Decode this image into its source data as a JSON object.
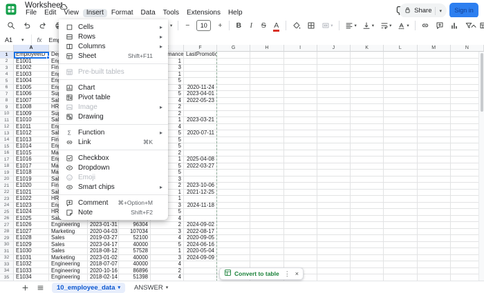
{
  "appbar": {
    "title": "Worksheet",
    "menu_items": [
      "File",
      "Edit",
      "View",
      "Insert",
      "Format",
      "Data",
      "Tools",
      "Extensions",
      "Help"
    ],
    "active_menu": "Insert",
    "share_label": "Share",
    "signin_label": "Sign in"
  },
  "icons": {
    "sigma": "Σ",
    "caret_down": "▾",
    "submenu_arrow": "▸",
    "minus": "−",
    "plus": "+",
    "bold": "B",
    "italic": "I",
    "strike": "S",
    "text_color": "A",
    "dots_vertical": "⋮",
    "close": "×"
  },
  "toolbar": {
    "font_size": "10"
  },
  "formula_bar": {
    "cell_ref": "A1",
    "fx": "fx",
    "value": "EmployeeID"
  },
  "insert_menu": {
    "items": [
      {
        "label": "Cells",
        "shortcut": "",
        "arrow": "▸",
        "disabled": false
      },
      {
        "label": "Rows",
        "shortcut": "",
        "arrow": "▸",
        "disabled": false
      },
      {
        "label": "Columns",
        "shortcut": "",
        "arrow": "▸",
        "disabled": false
      },
      {
        "label": "Sheet",
        "shortcut": "Shift+F11",
        "arrow": "",
        "disabled": false
      },
      {
        "label": "Pre-built tables",
        "shortcut": "",
        "arrow": "",
        "disabled": true
      },
      {
        "label": "Chart",
        "shortcut": "",
        "arrow": "",
        "disabled": false
      },
      {
        "label": "Pivot table",
        "shortcut": "",
        "arrow": "",
        "disabled": false
      },
      {
        "label": "Image",
        "shortcut": "",
        "arrow": "▸",
        "disabled": true
      },
      {
        "label": "Drawing",
        "shortcut": "",
        "arrow": "",
        "disabled": false
      },
      {
        "label": "Function",
        "shortcut": "",
        "arrow": "▸",
        "disabled": false
      },
      {
        "label": "Link",
        "shortcut": "⌘K",
        "arrow": "",
        "disabled": false
      },
      {
        "label": "Checkbox",
        "shortcut": "",
        "arrow": "",
        "disabled": false
      },
      {
        "label": "Dropdown",
        "shortcut": "",
        "arrow": "",
        "disabled": false
      },
      {
        "label": "Emoji",
        "shortcut": "",
        "arrow": "",
        "disabled": true
      },
      {
        "label": "Smart chips",
        "shortcut": "",
        "arrow": "▸",
        "disabled": false
      },
      {
        "label": "Comment",
        "shortcut": "⌘+Option+M",
        "arrow": "",
        "disabled": false
      },
      {
        "label": "Note",
        "shortcut": "Shift+F2",
        "arrow": "",
        "disabled": false
      }
    ]
  },
  "sheet": {
    "columns": [
      "A",
      "B",
      "C",
      "D",
      "E",
      "F",
      "G",
      "H",
      "I",
      "J",
      "K",
      "L",
      "M",
      "N"
    ],
    "selected_cell": "A1",
    "rows": [
      [
        "EmployeeID",
        "Department",
        "",
        "",
        "PerformanceRat",
        "LastPromotionDate"
      ],
      [
        "E1001",
        "Engineering",
        "",
        "",
        "1",
        ""
      ],
      [
        "E1002",
        "Finance",
        "",
        "",
        "3",
        ""
      ],
      [
        "E1003",
        "Engineering",
        "",
        "",
        "1",
        ""
      ],
      [
        "E1004",
        "Engineering",
        "",
        "",
        "5",
        ""
      ],
      [
        "E1005",
        "Engineering",
        "",
        "",
        "3",
        "2020-11-24"
      ],
      [
        "E1006",
        "Support",
        "",
        "",
        "5",
        "2023-04-01"
      ],
      [
        "E1007",
        "Sales",
        "",
        "",
        "4",
        "2022-05-23"
      ],
      [
        "E1008",
        "HR",
        "",
        "",
        "2",
        ""
      ],
      [
        "E1009",
        "Support",
        "",
        "",
        "2",
        ""
      ],
      [
        "E1010",
        "Sales",
        "",
        "",
        "1",
        "2023-03-21"
      ],
      [
        "E1011",
        "Engineering",
        "",
        "",
        "4",
        ""
      ],
      [
        "E1012",
        "Sales",
        "",
        "",
        "5",
        "2020-07-11"
      ],
      [
        "E1013",
        "Finance",
        "",
        "",
        "5",
        ""
      ],
      [
        "E1014",
        "Engineering",
        "",
        "",
        "5",
        ""
      ],
      [
        "E1015",
        "Marketing",
        "",
        "",
        "2",
        ""
      ],
      [
        "E1016",
        "Engineering",
        "",
        "",
        "1",
        "2025-04-08"
      ],
      [
        "E1017",
        "Marketing",
        "",
        "",
        "5",
        "2022-03-27"
      ],
      [
        "E1018",
        "Marketing",
        "",
        "",
        "5",
        ""
      ],
      [
        "E1019",
        "Sales",
        "",
        "",
        "3",
        ""
      ],
      [
        "E1020",
        "Finance",
        "",
        "",
        "2",
        "2023-10-06"
      ],
      [
        "E1021",
        "Sales",
        "",
        "",
        "1",
        "2021-12-25"
      ],
      [
        "E1022",
        "HR",
        "",
        "",
        "1",
        ""
      ],
      [
        "E1023",
        "Engineering",
        "",
        "",
        "3",
        "2024-11-18"
      ],
      [
        "E1024",
        "HR",
        "",
        "",
        "5",
        ""
      ],
      [
        "E1025",
        "Sales",
        "2019-11-03",
        "64961",
        "4",
        ""
      ],
      [
        "E1026",
        "Engineering",
        "2023-01-31",
        "96304",
        "2",
        "2024-09-02"
      ],
      [
        "E1027",
        "Marketing",
        "2020-04-03",
        "107034",
        "3",
        "2022-08-17"
      ],
      [
        "E1028",
        "Sales",
        "2019-03-27",
        "52100",
        "4",
        "2020-09-05"
      ],
      [
        "E1029",
        "Sales",
        "2023-04-17",
        "40000",
        "5",
        "2024-06-16"
      ],
      [
        "E1030",
        "Sales",
        "2018-08-12",
        "57528",
        "1",
        "2020-05-04"
      ],
      [
        "E1031",
        "Marketing",
        "2023-01-02",
        "40000",
        "3",
        "2024-09-09"
      ],
      [
        "E1032",
        "Engineering",
        "2018-07-07",
        "40000",
        "4",
        ""
      ],
      [
        "E1033",
        "Engineering",
        "2020-10-16",
        "86896",
        "2",
        ""
      ],
      [
        "E1034",
        "Engineering",
        "2018-02-14",
        "51398",
        "4",
        ""
      ]
    ]
  },
  "convert_pill": {
    "label": "Convert to table"
  },
  "tabs": {
    "active": "10_employee_data",
    "other": "ANSWER"
  },
  "colors": {
    "accent_blue": "#1a73e8",
    "tab_blue": "#0b57d0",
    "sheets_green": "#188038",
    "selection": "#1a73e8"
  }
}
